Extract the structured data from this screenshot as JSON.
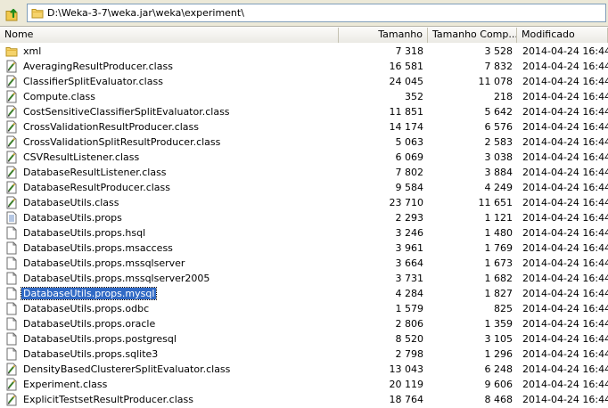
{
  "address": {
    "path": "D:\\Weka-3-7\\weka.jar\\weka\\experiment\\"
  },
  "columns": {
    "name": "Nome",
    "size": "Tamanho",
    "compressed": "Tamanho Comp...",
    "modified": "Modificado"
  },
  "colors": {
    "selection": "#316ac5",
    "header_bg": "#f3f2ec",
    "address_border": "#7f9db9"
  },
  "files": [
    {
      "name": "xml",
      "size": "7 318",
      "compressed": "3 528",
      "modified": "2014-04-24 16:44",
      "icon": "folder-icon"
    },
    {
      "name": "AveragingResultProducer.class",
      "size": "16 581",
      "compressed": "7 832",
      "modified": "2014-04-24 16:44",
      "icon": "class-file-icon"
    },
    {
      "name": "ClassifierSplitEvaluator.class",
      "size": "24 045",
      "compressed": "11 078",
      "modified": "2014-04-24 16:44",
      "icon": "class-file-icon"
    },
    {
      "name": "Compute.class",
      "size": "352",
      "compressed": "218",
      "modified": "2014-04-24 16:44",
      "icon": "class-file-icon"
    },
    {
      "name": "CostSensitiveClassifierSplitEvaluator.class",
      "size": "11 851",
      "compressed": "5 642",
      "modified": "2014-04-24 16:44",
      "icon": "class-file-icon"
    },
    {
      "name": "CrossValidationResultProducer.class",
      "size": "14 174",
      "compressed": "6 576",
      "modified": "2014-04-24 16:44",
      "icon": "class-file-icon"
    },
    {
      "name": "CrossValidationSplitResultProducer.class",
      "size": "5 063",
      "compressed": "2 583",
      "modified": "2014-04-24 16:44",
      "icon": "class-file-icon"
    },
    {
      "name": "CSVResultListener.class",
      "size": "6 069",
      "compressed": "3 038",
      "modified": "2014-04-24 16:44",
      "icon": "class-file-icon"
    },
    {
      "name": "DatabaseResultListener.class",
      "size": "7 802",
      "compressed": "3 884",
      "modified": "2014-04-24 16:44",
      "icon": "class-file-icon"
    },
    {
      "name": "DatabaseResultProducer.class",
      "size": "9 584",
      "compressed": "4 249",
      "modified": "2014-04-24 16:44",
      "icon": "class-file-icon"
    },
    {
      "name": "DatabaseUtils.class",
      "size": "23 710",
      "compressed": "11 651",
      "modified": "2014-04-24 16:44",
      "icon": "class-file-icon"
    },
    {
      "name": "DatabaseUtils.props",
      "size": "2 293",
      "compressed": "1 121",
      "modified": "2014-04-24 16:44",
      "icon": "props-file-icon"
    },
    {
      "name": "DatabaseUtils.props.hsql",
      "size": "3 246",
      "compressed": "1 480",
      "modified": "2014-04-24 16:44",
      "icon": "blank-file-icon"
    },
    {
      "name": "DatabaseUtils.props.msaccess",
      "size": "3 961",
      "compressed": "1 769",
      "modified": "2014-04-24 16:44",
      "icon": "blank-file-icon"
    },
    {
      "name": "DatabaseUtils.props.mssqlserver",
      "size": "3 664",
      "compressed": "1 673",
      "modified": "2014-04-24 16:44",
      "icon": "blank-file-icon"
    },
    {
      "name": "DatabaseUtils.props.mssqlserver2005",
      "size": "3 731",
      "compressed": "1 682",
      "modified": "2014-04-24 16:44",
      "icon": "blank-file-icon"
    },
    {
      "name": "DatabaseUtils.props.mysql",
      "size": "4 284",
      "compressed": "1 827",
      "modified": "2014-04-24 16:44",
      "icon": "blank-file-icon",
      "selected": true
    },
    {
      "name": "DatabaseUtils.props.odbc",
      "size": "1 579",
      "compressed": "825",
      "modified": "2014-04-24 16:44",
      "icon": "blank-file-icon"
    },
    {
      "name": "DatabaseUtils.props.oracle",
      "size": "2 806",
      "compressed": "1 359",
      "modified": "2014-04-24 16:44",
      "icon": "blank-file-icon"
    },
    {
      "name": "DatabaseUtils.props.postgresql",
      "size": "8 520",
      "compressed": "3 105",
      "modified": "2014-04-24 16:44",
      "icon": "blank-file-icon"
    },
    {
      "name": "DatabaseUtils.props.sqlite3",
      "size": "2 798",
      "compressed": "1 296",
      "modified": "2014-04-24 16:44",
      "icon": "blank-file-icon"
    },
    {
      "name": "DensityBasedClustererSplitEvaluator.class",
      "size": "13 043",
      "compressed": "6 248",
      "modified": "2014-04-24 16:44",
      "icon": "class-file-icon"
    },
    {
      "name": "Experiment.class",
      "size": "20 119",
      "compressed": "9 606",
      "modified": "2014-04-24 16:44",
      "icon": "class-file-icon"
    },
    {
      "name": "ExplicitTestsetResultProducer.class",
      "size": "18 764",
      "compressed": "8 468",
      "modified": "2014-04-24 16:44",
      "icon": "class-file-icon"
    }
  ]
}
